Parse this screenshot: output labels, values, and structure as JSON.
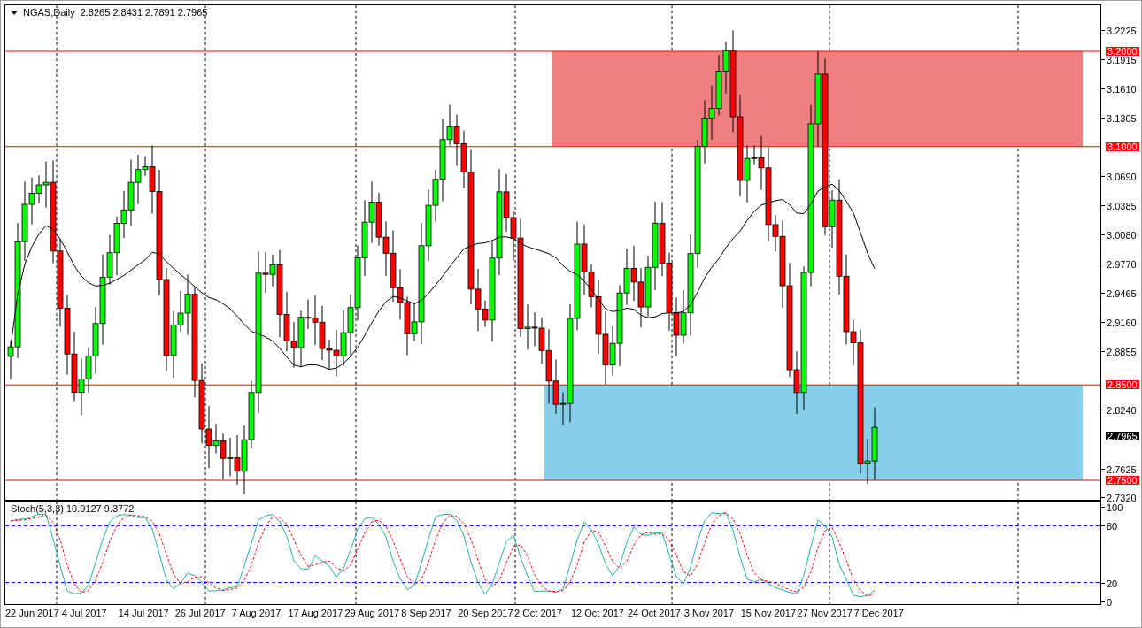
{
  "header": {
    "symbol": "NGAS,Daily",
    "ohlc": "2.8265 2.8431 2.7891 2.7965"
  },
  "price_scale": {
    "ticks": [
      "3.2225",
      "3.1915",
      "3.1610",
      "3.1305",
      "3.0690",
      "3.0385",
      "3.0080",
      "2.9770",
      "2.9465",
      "2.9160",
      "2.8855",
      "2.8240",
      "2.7625",
      "2.7320"
    ],
    "tags": [
      {
        "label": "3.2000",
        "kind": "level"
      },
      {
        "label": "3.1000",
        "kind": "level"
      },
      {
        "label": "2.8500",
        "kind": "level"
      },
      {
        "label": "2.7965",
        "kind": "current"
      },
      {
        "label": "2.7500",
        "kind": "level"
      }
    ]
  },
  "stochastic": {
    "title": "Stoch(5,3,3) 10.9127 9.3772",
    "ticks": [
      "100",
      "80",
      "20",
      "0"
    ]
  },
  "time_axis": {
    "labels": [
      "22 Jun 2017",
      "4 Jul 2017",
      "14 Jul 2017",
      "26 Jul 2017",
      "7 Aug 2017",
      "17 Aug 2017",
      "29 Aug 2017",
      "8 Sep 2017",
      "20 Sep 2017",
      "2 Oct 2017",
      "12 Oct 2017",
      "24 Oct 2017",
      "3 Nov 2017",
      "15 Nov 2017",
      "27 Nov 2017",
      "7 Dec 2017"
    ]
  }
}
